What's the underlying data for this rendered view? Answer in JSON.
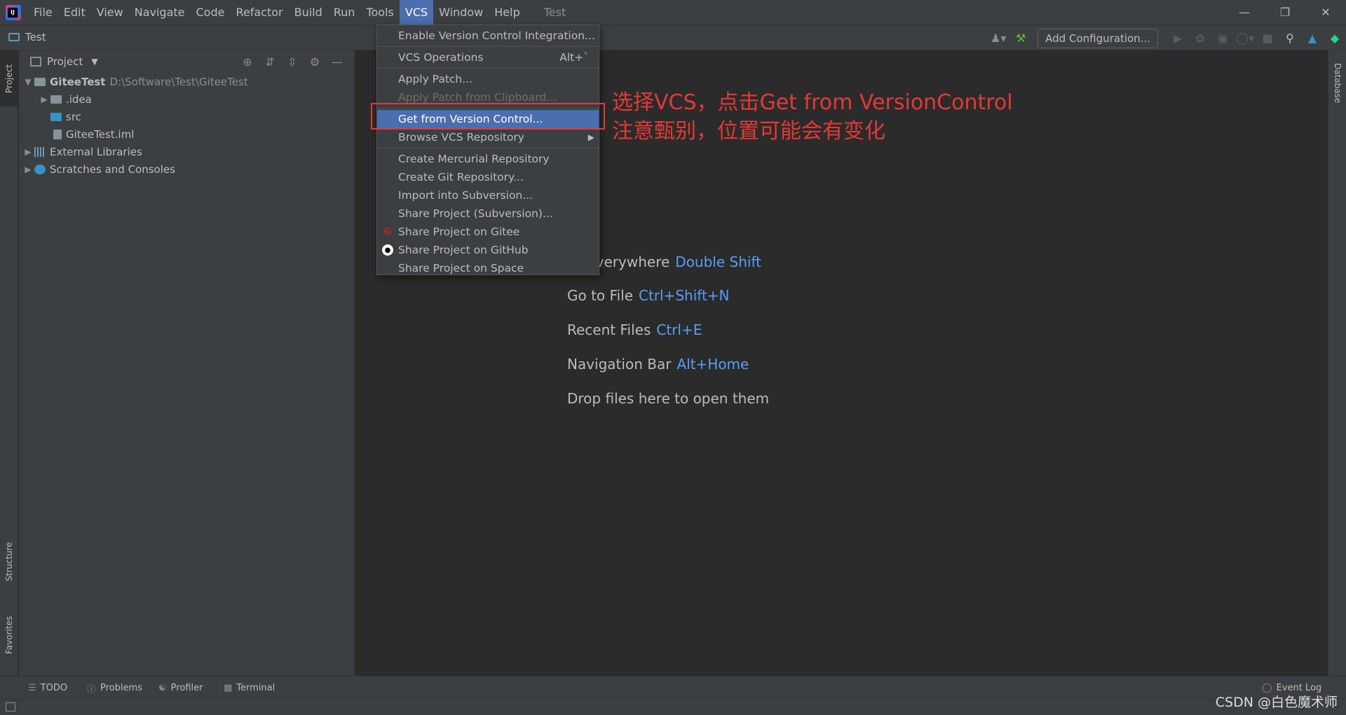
{
  "menu": {
    "items": [
      "File",
      "Edit",
      "View",
      "Navigate",
      "Code",
      "Refactor",
      "Build",
      "Run",
      "Tools",
      "VCS",
      "Window",
      "Help"
    ],
    "active": "VCS",
    "window_title": "Test"
  },
  "window_controls": {
    "minimize": "—",
    "restore": "❐",
    "close": "✕"
  },
  "navbar": {
    "project_name": "Test",
    "add_configuration": "Add Configuration..."
  },
  "left_stripe": {
    "project": "Project",
    "structure": "Structure",
    "favorites": "Favorites"
  },
  "right_stripe": {
    "database": "Database"
  },
  "project_panel": {
    "title": "Project",
    "tree": {
      "root_name": "GiteeTest",
      "root_path": "D:\\Software\\Test\\GiteeTest",
      "idea": ".idea",
      "src": "src",
      "iml": "GiteeTest.iml",
      "external": "External Libraries",
      "scratches": "Scratches and Consoles"
    }
  },
  "vcs_menu": {
    "enable_vc": "Enable Version Control Integration...",
    "vcs_operations": "VCS Operations",
    "vcs_operations_shortcut": "Alt+`",
    "apply_patch": "Apply Patch...",
    "apply_patch_clipboard": "Apply Patch from Clipboard...",
    "get_from_vc": "Get from Version Control...",
    "browse_repo": "Browse VCS Repository",
    "create_mercurial": "Create Mercurial Repository",
    "create_git": "Create Git Repository...",
    "import_svn": "Import into Subversion...",
    "share_svn": "Share Project (Subversion)...",
    "share_gitee": "Share Project on Gitee",
    "share_github": "Share Project on GitHub",
    "share_space": "Share Project on Space"
  },
  "editor_hints": {
    "search_label": "ch Everywhere",
    "search_key": "Double Shift",
    "goto_label": "Go to File",
    "goto_key": "Ctrl+Shift+N",
    "recent_label": "Recent Files",
    "recent_key": "Ctrl+E",
    "navbar_label": "Navigation Bar",
    "navbar_key": "Alt+Home",
    "drop_label": "Drop files here to open them"
  },
  "annotation": {
    "line1": "选择VCS，点击Get from VersionControl",
    "line2": "注意甄别，位置可能会有变化"
  },
  "bottom_tabs": {
    "todo": "TODO",
    "problems": "Problems",
    "profiler": "Profiler",
    "terminal": "Terminal",
    "event_log": "Event Log"
  },
  "watermark": "CSDN @白色魔术师",
  "colors": {
    "accent": "#4b6eaf",
    "annotation": "#e53935",
    "link_key": "#589df6",
    "background": "#2b2b2b"
  }
}
